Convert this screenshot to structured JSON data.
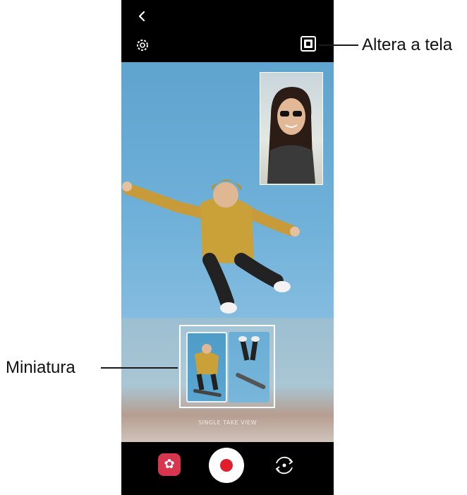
{
  "annotations": {
    "switch_screen": "Altera a tela",
    "thumbnail": "Miniatura"
  },
  "camera": {
    "thumbnail_mode_label": "SINGLE TAKE VIEW",
    "icons": {
      "back": "chevron-left-icon",
      "settings": "gear-icon",
      "switch_view": "picture-in-picture-icon",
      "effects": "flower-icon",
      "record": "record-icon",
      "flip": "flip-camera-icon"
    },
    "colors": {
      "record": "#e01e2e",
      "effects": "#d8354f",
      "sky": "#6eb0d8"
    }
  }
}
